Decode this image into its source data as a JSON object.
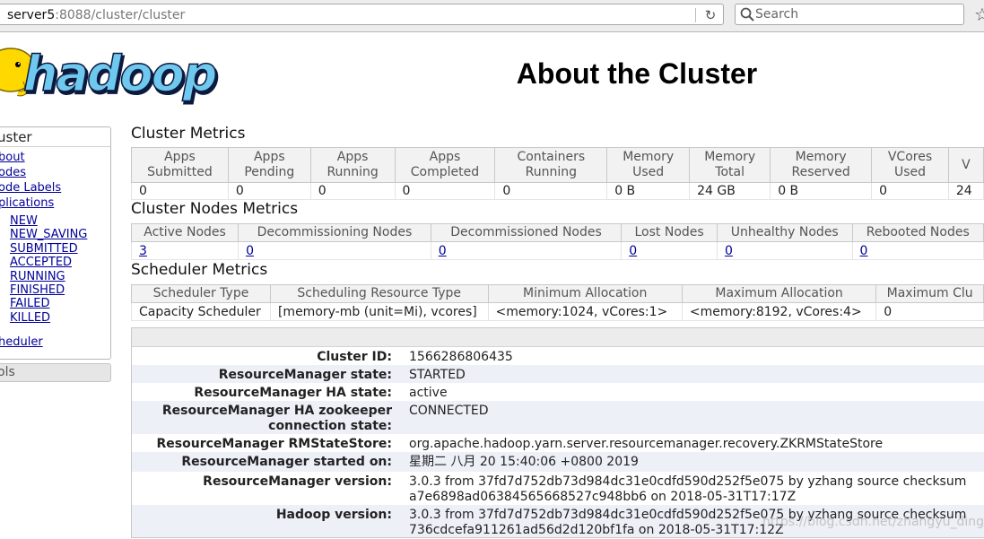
{
  "browser": {
    "url_host": "server5",
    "url_rest": ":8088/cluster/cluster",
    "search_placeholder": "Search"
  },
  "header": {
    "logo_text": "hadoop",
    "title": "About the Cluster"
  },
  "nav": {
    "heading": "uster",
    "links": [
      "bout",
      "odes",
      "ode Labels",
      "plications"
    ],
    "app_states": [
      "NEW",
      "NEW_SAVING",
      "SUBMITTED",
      "ACCEPTED",
      "RUNNING",
      "FINISHED",
      "FAILED",
      "KILLED"
    ],
    "scheduler": "heduler",
    "tools": "ols"
  },
  "cluster_metrics": {
    "title": "Cluster Metrics",
    "headers": [
      [
        "Apps",
        "Submitted"
      ],
      [
        "Apps",
        "Pending"
      ],
      [
        "Apps",
        "Running"
      ],
      [
        "Apps",
        "Completed"
      ],
      [
        "Containers",
        "Running"
      ],
      [
        "Memory",
        "Used"
      ],
      [
        "Memory",
        "Total"
      ],
      [
        "Memory",
        "Reserved"
      ],
      [
        "VCores",
        "Used"
      ],
      [
        "V"
      ]
    ],
    "values": [
      "0",
      "0",
      "0",
      "0",
      "0",
      "0 B",
      "24 GB",
      "0 B",
      "0",
      "24"
    ]
  },
  "node_metrics": {
    "title": "Cluster Nodes Metrics",
    "headers": [
      "Active Nodes",
      "Decommissioning Nodes",
      "Decommissioned Nodes",
      "Lost Nodes",
      "Unhealthy Nodes",
      "Rebooted Nodes"
    ],
    "values": [
      "3",
      "0",
      "0",
      "0",
      "0",
      "0"
    ]
  },
  "scheduler_metrics": {
    "title": "Scheduler Metrics",
    "headers": [
      "Scheduler Type",
      "Scheduling Resource Type",
      "Minimum Allocation",
      "Maximum Allocation",
      "Maximum Clu"
    ],
    "values": [
      "Capacity Scheduler",
      "[memory-mb (unit=Mi), vcores]",
      "<memory:1024, vCores:1>",
      "<memory:8192, vCores:4>",
      "0"
    ]
  },
  "about": [
    {
      "key": [
        "Cluster ID:"
      ],
      "value": [
        "1566286806435"
      ]
    },
    {
      "key": [
        "ResourceManager state:"
      ],
      "value": [
        "STARTED"
      ]
    },
    {
      "key": [
        "ResourceManager HA state:"
      ],
      "value": [
        "active"
      ]
    },
    {
      "key": [
        "ResourceManager HA zookeeper",
        "connection state:"
      ],
      "value": [
        "CONNECTED"
      ]
    },
    {
      "key": [
        "ResourceManager RMStateStore:"
      ],
      "value": [
        "org.apache.hadoop.yarn.server.resourcemanager.recovery.ZKRMStateStore"
      ]
    },
    {
      "key": [
        "ResourceManager started on:"
      ],
      "value": [
        "星期二 八月 20 15:40:06 +0800 2019"
      ]
    },
    {
      "key": [
        "ResourceManager version:"
      ],
      "value": [
        "3.0.3 from 37fd7d752db73d984dc31e0cdfd590d252f5e075 by yzhang source checksum",
        "a7e6898ad06384565668527c948bb6 on 2018-05-31T17:17Z"
      ]
    },
    {
      "key": [
        "Hadoop version:"
      ],
      "value": [
        "3.0.3 from 37fd7d752db73d984dc31e0cdfd590d252f5e075 by yzhang source checksum",
        "736cdcefa911261ad56d2d120bf1fa on 2018-05-31T17:12Z"
      ]
    }
  ],
  "watermark": "https://blog.csdn.net/zhangyu_ding"
}
